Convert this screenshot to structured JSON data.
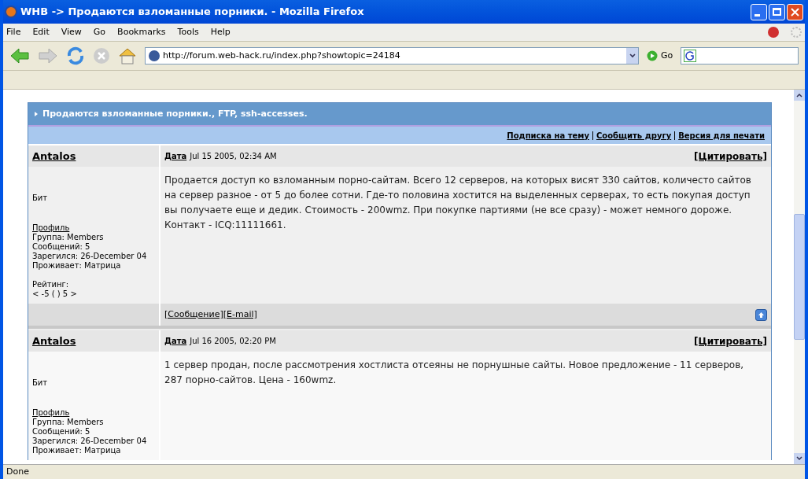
{
  "window": {
    "title": "WHB -> Продаются взломанные порники. - Mozilla Firefox"
  },
  "menu": [
    "File",
    "Edit",
    "View",
    "Go",
    "Bookmarks",
    "Tools",
    "Help"
  ],
  "toolbar": {
    "url": "http://forum.web-hack.ru/index.php?showtopic=24184",
    "go_label": "Go"
  },
  "topic": {
    "title": "Продаются взломанные порники., FTP, ssh-accesses.",
    "links": [
      "Подписка на тему",
      "Сообщить другу",
      "Версия для печати"
    ]
  },
  "posts": [
    {
      "author": "Antalos",
      "date_label": "Дата",
      "date": "Jul 15 2005, 02:34 AM",
      "quote": "[Цитировать]",
      "rank": "Бит",
      "profile": "Профиль",
      "details": [
        "Группа: Members",
        "Сообщений: 5",
        "Зарегился: 26-December 04",
        "Проживает: Матрица"
      ],
      "rating_label": "Рейтинг:",
      "rating": "< -5 ( ) 5 >",
      "body": "Продается доступ ко взломанным порно-сайтам. Всего 12 серверов, на которых висят 330 сайтов, количесто сайтов на сервер разное - от 5 до более сотни. Где-то половина хостится на выделенных серверах, то есть покупая доступ вы получаете еще и дедик. Стоимость - 200wmz. При покупке партиями (не все сразу) - может немного дороже. Контакт - ICQ:11111661.",
      "footer_links": [
        "[Сообщение]",
        "[E-mail]"
      ]
    },
    {
      "author": "Antalos",
      "date_label": "Дата",
      "date": "Jul 16 2005, 02:20 PM",
      "quote": "[Цитировать]",
      "rank": "Бит",
      "profile": "Профиль",
      "details": [
        "Группа: Members",
        "Сообщений: 5",
        "Зарегился: 26-December 04",
        "Проживает: Матрица"
      ],
      "body": "1 сервер продан, после рассмотрения хостлиста отсеяны не порнушные сайты. Новое предложение - 11 серверов, 287 порно-сайтов. Цена - 160wmz."
    }
  ],
  "status_bar": {
    "text": "Done"
  }
}
